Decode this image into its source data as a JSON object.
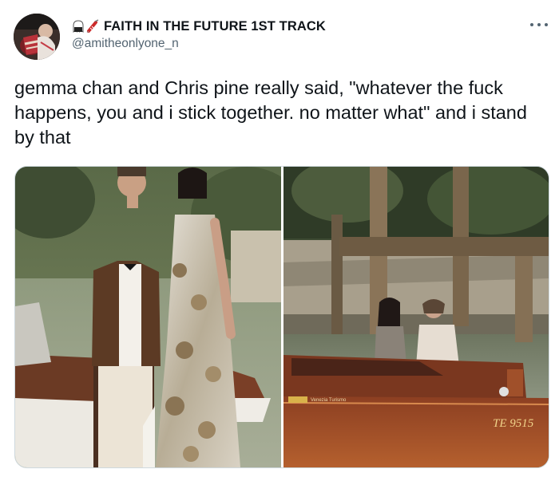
{
  "author": {
    "name": "FAITH IN THE FUTURE 1ST TRACK",
    "handle": "@amitheonlyone_n",
    "avatar_icon": "avatar-photo",
    "name_emojis": [
      "ghost-emoji",
      "syringe-emoji"
    ]
  },
  "tweet": {
    "text": "gemma chan and Chris pine really said, \"whatever the fuck happens, you and i stick together. no matter what\" and i stand by that"
  },
  "media": {
    "boat_number": "TE 9515",
    "boat_brand": "Venezia Turismo"
  },
  "colors": {
    "text": "#0f1419",
    "secondary": "#536471",
    "border": "#cfd9de"
  }
}
